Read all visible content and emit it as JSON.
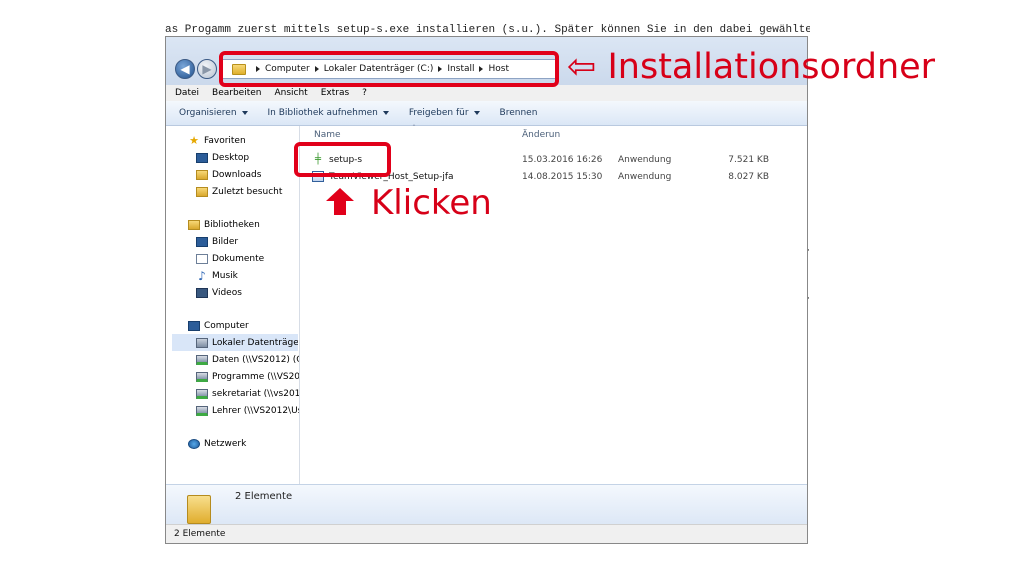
{
  "background_doc_text": "as Progamm zuerst mittels setup-s.exe installieren (s.u.). Später können Sie in den dabei gewählten Ordner übe",
  "explorer": {
    "address_path": [
      "Computer",
      "Lokaler Datenträger (C:)",
      "Install",
      "Host"
    ],
    "menu": [
      "Datei",
      "Bearbeiten",
      "Ansicht",
      "Extras",
      "?"
    ],
    "toolbar": [
      "Organisieren",
      "In Bibliothek aufnehmen",
      "Freigeben für",
      "Brennen"
    ],
    "nav": [
      {
        "label": "Favoriten",
        "icon": "star-icon"
      },
      {
        "label": "Desktop",
        "icon": "monitor-icon"
      },
      {
        "label": "Downloads",
        "icon": "folder-icon"
      },
      {
        "label": "Zuletzt besucht",
        "icon": "folder-icon"
      },
      {
        "label": "Bibliotheken",
        "icon": "folder-icon"
      },
      {
        "label": "Bilder",
        "icon": "image-folder-icon"
      },
      {
        "label": "Dokumente",
        "icon": "document-icon"
      },
      {
        "label": "Musik",
        "icon": "music-icon"
      },
      {
        "label": "Videos",
        "icon": "video-icon"
      },
      {
        "label": "Computer",
        "icon": "computer-icon"
      },
      {
        "label": "Lokaler Datenträger",
        "icon": "drive-icon"
      },
      {
        "label": "Daten (\\\\VS2012) (G:",
        "icon": "network-drive-icon"
      },
      {
        "label": "Programme (\\\\VS20",
        "icon": "network-drive-icon"
      },
      {
        "label": "sekretariat (\\\\vs2012",
        "icon": "network-drive-icon"
      },
      {
        "label": "Lehrer (\\\\VS2012\\Us",
        "icon": "network-drive-icon"
      },
      {
        "label": "Netzwerk",
        "icon": "network-icon"
      }
    ],
    "columns": {
      "name": "Name",
      "date": "Änderun"
    },
    "files": [
      {
        "name": "setup-s",
        "date": "15.03.2016 16:26",
        "type": "Anwendung",
        "size": "7.521 KB"
      },
      {
        "name": "TeamViewer_Host_Setup-jfa",
        "date": "14.08.2015 15:30",
        "type": "Anwendung",
        "size": "8.027 KB"
      }
    ],
    "details_count": "2 Elemente",
    "status_count": "2 Elemente"
  },
  "annotations": {
    "install_folder": "⇦ Installationsordner",
    "click": "Klicken"
  },
  "colors": {
    "highlight": "#e1001a",
    "window_blue": "#dbe6f4",
    "text": "#111111"
  }
}
